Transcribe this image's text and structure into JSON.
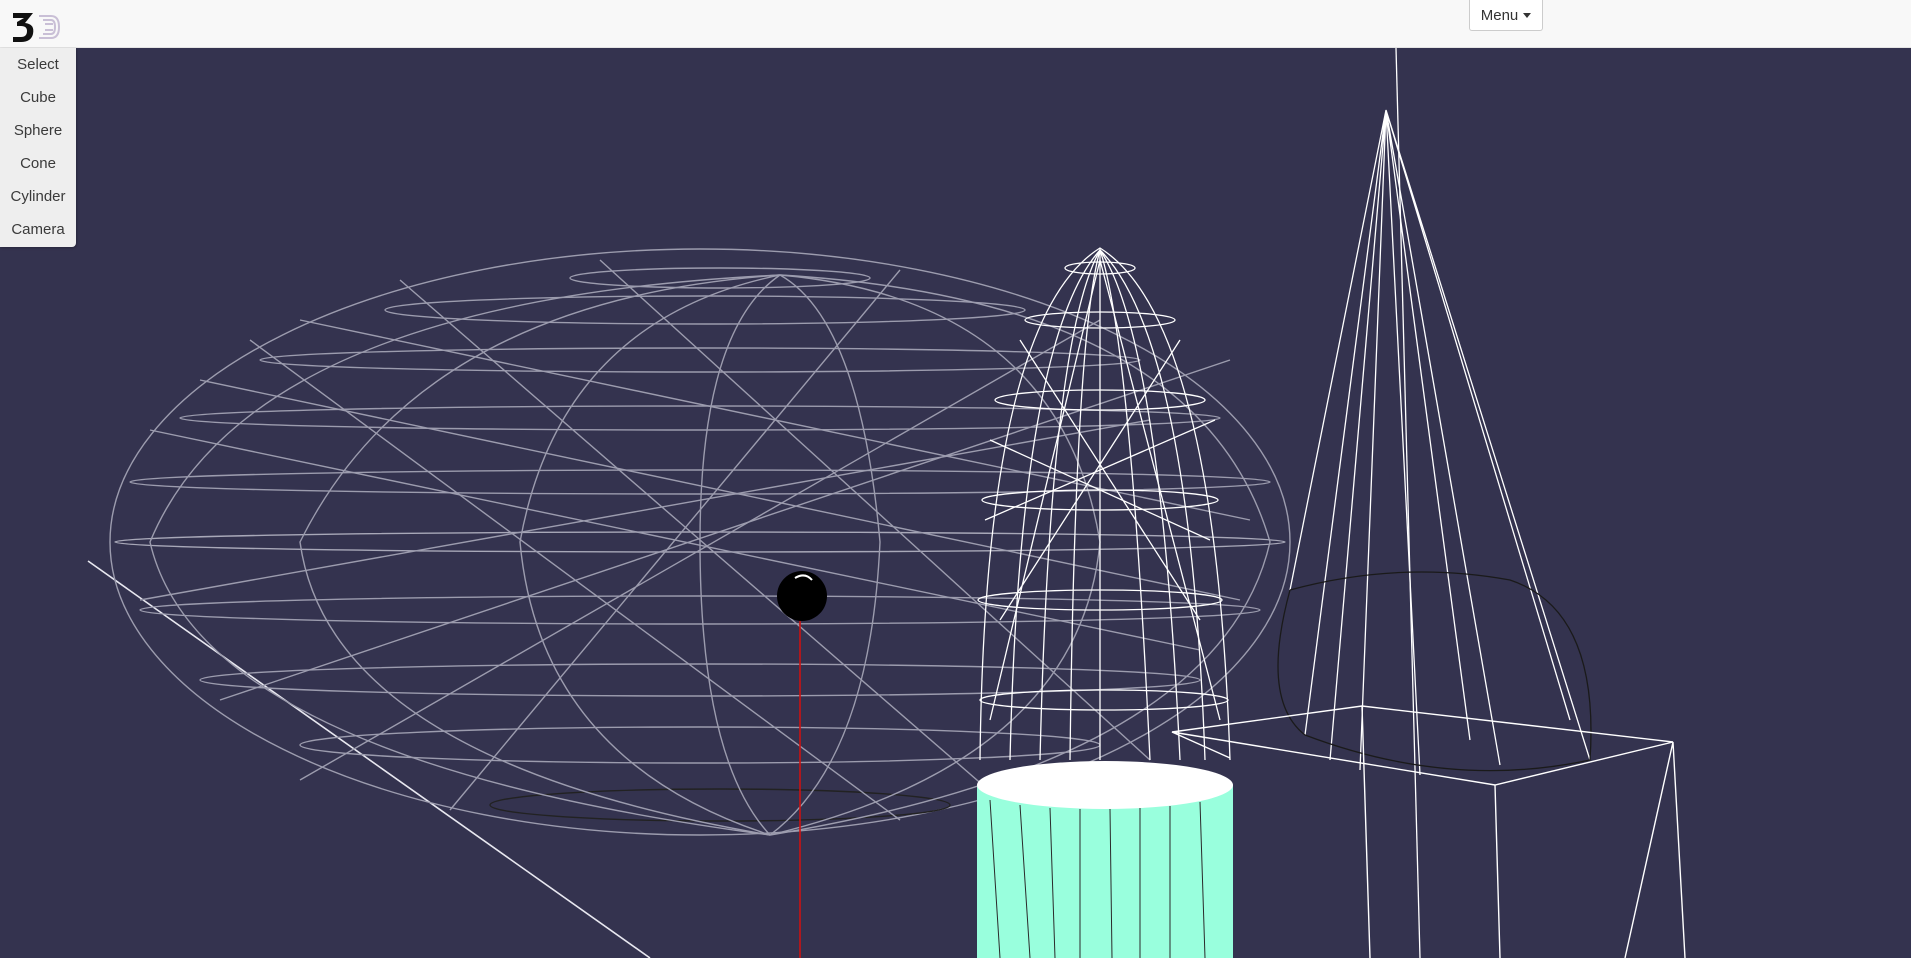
{
  "app": {
    "logo_icon": "3d-editor-logo-icon"
  },
  "header": {
    "menu_label": "Menu",
    "menu_icon": "caret-down-icon"
  },
  "toolbar": {
    "items": [
      {
        "label": "Select"
      },
      {
        "label": "Cube"
      },
      {
        "label": "Sphere"
      },
      {
        "label": "Cone"
      },
      {
        "label": "Cylinder"
      },
      {
        "label": "Camera"
      }
    ]
  },
  "scene": {
    "background": "#34334f",
    "wireframe_color": "#ffffff",
    "cylinder_fill": "#99ffdd",
    "axis_color": "#cc1111",
    "objects": [
      "ellipsoid-wireframe",
      "tall-sphere-wireframe",
      "cylinder",
      "cone-wireframe",
      "camera-frustum",
      "camera-handle-sphere"
    ]
  }
}
